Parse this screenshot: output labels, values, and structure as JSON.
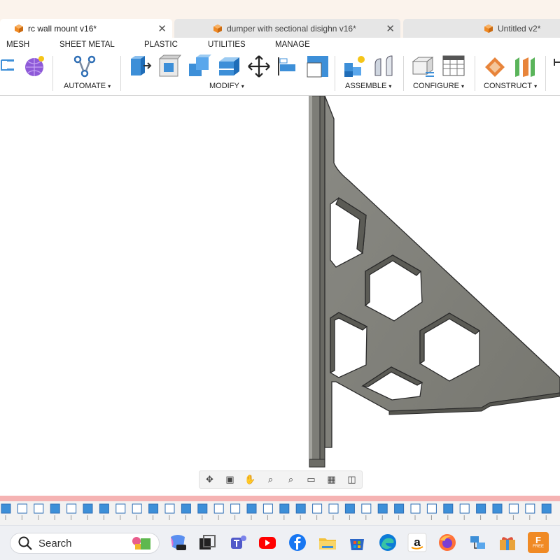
{
  "tabs": [
    {
      "title": "rc wall mount v16*",
      "active": true
    },
    {
      "title": "dumper with sectional disighn v16*",
      "active": false
    },
    {
      "title": "Untitled v2*",
      "active": false
    }
  ],
  "tab_close_glyph": "✕",
  "menu": [
    "MESH",
    "SHEET METAL",
    "PLASTIC",
    "UTILITIES",
    "MANAGE"
  ],
  "groups": {
    "automate": "AUTOMATE",
    "modify": "MODIFY",
    "assemble": "ASSEMBLE",
    "configure": "CONFIGURE",
    "construct": "CONSTRUCT"
  },
  "dropdown_caret": "▾",
  "taskbar": {
    "search_placeholder": "Search",
    "fusion_badge": "FREE"
  },
  "colors": {
    "accent_orange": "#f08a24",
    "tool_blue": "#3d8fd8",
    "part_gray": "#7d7d77",
    "timeline_red": "#f5b3b3"
  },
  "icons": {
    "tools": [
      "hierarchy-icon",
      "mesh-sphere-icon",
      "automate-icon",
      "press-pull-icon",
      "fillet-icon",
      "combine-icon",
      "shell-icon",
      "move-icon",
      "align-icon",
      "scale-icon",
      "new-component-icon",
      "joint-icon",
      "parameters-icon",
      "configure-table-icon",
      "offset-plane-icon",
      "midplane-icon"
    ],
    "nav": [
      "orbit-icon",
      "look-at-icon",
      "pan-icon",
      "zoom-icon",
      "zoom-window-icon",
      "display-settings-icon",
      "grid-icon",
      "viewports-icon"
    ],
    "taskbar": [
      "copilot-icon",
      "task-view-icon",
      "teams-icon",
      "youtube-icon",
      "facebook-icon",
      "file-explorer-icon",
      "store-icon",
      "edge-icon",
      "amazon-icon",
      "firefox-icon",
      "network-icon",
      "gift-icon",
      "fusion-icon"
    ]
  }
}
